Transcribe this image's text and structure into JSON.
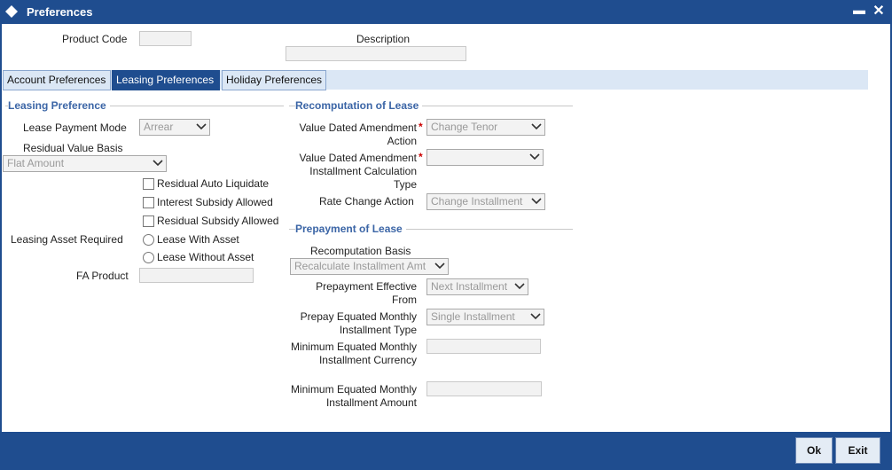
{
  "window": {
    "title": "Preferences",
    "minimize_label": "▬",
    "close_label": "✕"
  },
  "header": {
    "product_code_label": "Product Code",
    "product_code_value": "",
    "description_label": "Description",
    "description_value": ""
  },
  "tabs": [
    {
      "label": "Account Preferences",
      "active": false
    },
    {
      "label": "Leasing Preferences",
      "active": true
    },
    {
      "label": "Holiday Preferences",
      "active": false
    }
  ],
  "leasing_preference": {
    "title": "Leasing Preference",
    "lease_payment_mode_label": "Lease Payment Mode",
    "lease_payment_mode_value": "Arrear",
    "residual_value_basis_label": "Residual Value Basis",
    "residual_value_basis_value": "Flat Amount",
    "residual_auto_liquidate_label": "Residual Auto Liquidate",
    "interest_subsidy_allowed_label": "Interest Subsidy Allowed",
    "residual_subsidy_allowed_label": "Residual Subsidy Allowed",
    "leasing_asset_required_label": "Leasing Asset Required",
    "lease_with_asset_label": "Lease With Asset",
    "lease_without_asset_label": "Lease Without Asset",
    "fa_product_label": "FA Product",
    "fa_product_value": ""
  },
  "recomputation": {
    "title": "Recomputation of Lease",
    "vda_action_label": "Value Dated Amendment Action",
    "vda_action_value": "Change Tenor",
    "vda_installment_label": "Value Dated Amendment Installment Calculation Type",
    "vda_installment_value": "",
    "rate_change_action_label": "Rate Change Action",
    "rate_change_action_value": "Change Installment",
    "required_marker": "*"
  },
  "prepayment": {
    "title": "Prepayment of Lease",
    "recomputation_basis_label": "Recomputation Basis",
    "recomputation_basis_value": "Recalculate Installment Amt",
    "effective_from_label": "Prepayment Effective From",
    "effective_from_value": "Next Installment",
    "emi_type_label": "Prepay Equated Monthly Installment Type",
    "emi_type_value": "Single Installment",
    "min_emi_currency_label": "Minimum Equated Monthly Installment Currency",
    "min_emi_currency_value": "",
    "min_emi_amount_label": "Minimum Equated Monthly Installment Amount",
    "min_emi_amount_value": ""
  },
  "footer": {
    "ok_label": "Ok",
    "exit_label": "Exit"
  },
  "colors": {
    "titlebar": "#1f4d8f",
    "section_title": "#3b65a6",
    "active_tab": "#1f4d8f",
    "tab": "#dbe7f5",
    "required": "#cc0000"
  },
  "icons": {
    "window": "diamond-icon",
    "dropdown": "chevron-down-icon"
  }
}
